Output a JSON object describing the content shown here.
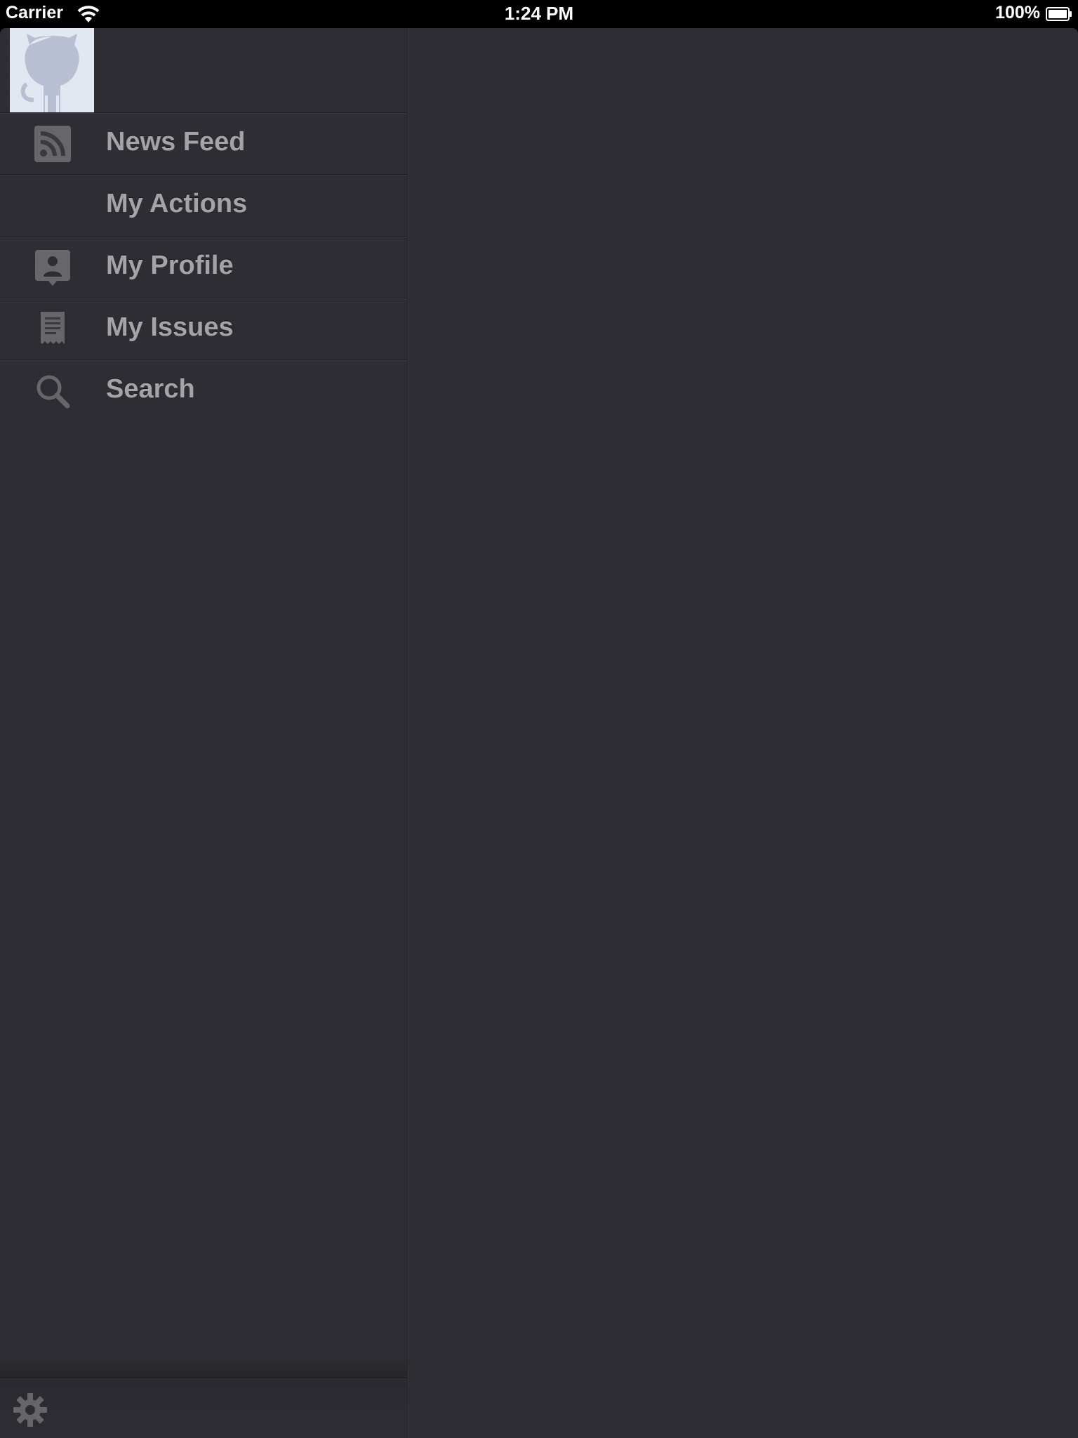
{
  "status_bar": {
    "carrier": "Carrier",
    "time": "1:24 PM",
    "battery_percent": "100%",
    "icons": [
      "wifi-icon",
      "battery-icon"
    ]
  },
  "sidebar": {
    "avatar_icon": "octocat-avatar",
    "items": [
      {
        "label": "News Feed",
        "icon": "rss-icon"
      },
      {
        "label": "My Actions",
        "icon": ""
      },
      {
        "label": "My Profile",
        "icon": "profile-icon"
      },
      {
        "label": "My Issues",
        "icon": "issues-icon"
      },
      {
        "label": "Search",
        "icon": "search-icon"
      }
    ],
    "footer_icon": "gear-icon"
  },
  "colors": {
    "background": "#2e2d33",
    "label": "#a3a3a8",
    "icon": "#6c6c70",
    "avatar_bg": "#e3e7f1",
    "octocat": "#b9bfd2"
  }
}
